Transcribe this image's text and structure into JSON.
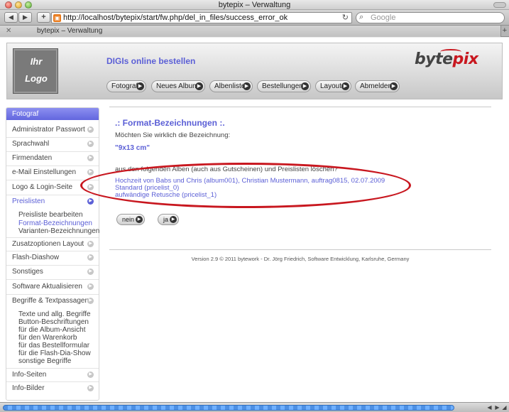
{
  "window": {
    "title": "bytepix – Verwaltung"
  },
  "toolbar": {
    "back_icon": "◀",
    "forward_icon": "▶",
    "add_icon": "+",
    "url": "http://localhost/bytepix/start/fw.php/del_in_files/success_error_ok",
    "search_placeholder": "Google"
  },
  "tab": {
    "label": "bytepix – Verwaltung"
  },
  "header": {
    "logo_line1": "Ihr",
    "logo_line2": "Logo",
    "shop_title": "DIGIs online bestellen",
    "brand_byte": "byte",
    "brand_pix": "pix",
    "nav": [
      "Fotograf",
      "Neues Album",
      "Albenliste",
      "Bestellungen",
      "Layout",
      "Abmelden"
    ]
  },
  "sidebar": {
    "heading": "Fotograf",
    "items": [
      "Administrator Passwort",
      "Sprachwahl",
      "Firmendaten",
      "e-Mail Einstellungen",
      "Logo & Login-Seite",
      "Preislisten",
      "Zusatzoptionen Layout",
      "Flash-Diashow",
      "Sonstiges",
      "Software Aktualisieren",
      "Begriffe & Textpassagen",
      "Info-Seiten",
      "Info-Bilder"
    ],
    "preislisten_sub": [
      "Preisliste bearbeiten",
      "Format-Bezeichnungen",
      "Varianten-Bezeichnungen"
    ],
    "begriffe_sub": [
      "Texte und allg. Begriffe",
      "Button-Beschriftungen",
      "für die Album-Ansicht",
      "für den Warenkorb",
      "für das Bestellformular",
      "für die Flash-Dia-Show",
      "sonstige Begriffe"
    ]
  },
  "main": {
    "title": ".: Format-Bezeichnungen :.",
    "question": "Möchten Sie wirklich die Bezeichnung:",
    "term": "\"9x13 cm\"",
    "albums_note": "aus den folgenden Alben (auch aus Gutscheinen) und Preislisten löschen?",
    "links": [
      "Hochzeit von Babs und Chris (album001), Christian Mustermann, auftrag0815, 02.07.2009",
      "Standard (pricelist_0)",
      "aufwändige Retusche (pricelist_1)"
    ],
    "btn_no": "nein",
    "btn_yes": "ja",
    "footer": "Version 2.9 © 2011 bytework - Dr. Jörg Friedrich, Software Entwicklung, Karlsruhe, Germany"
  },
  "colors": {
    "accent": "#5b5fd6",
    "highlight": "#c8171f"
  }
}
